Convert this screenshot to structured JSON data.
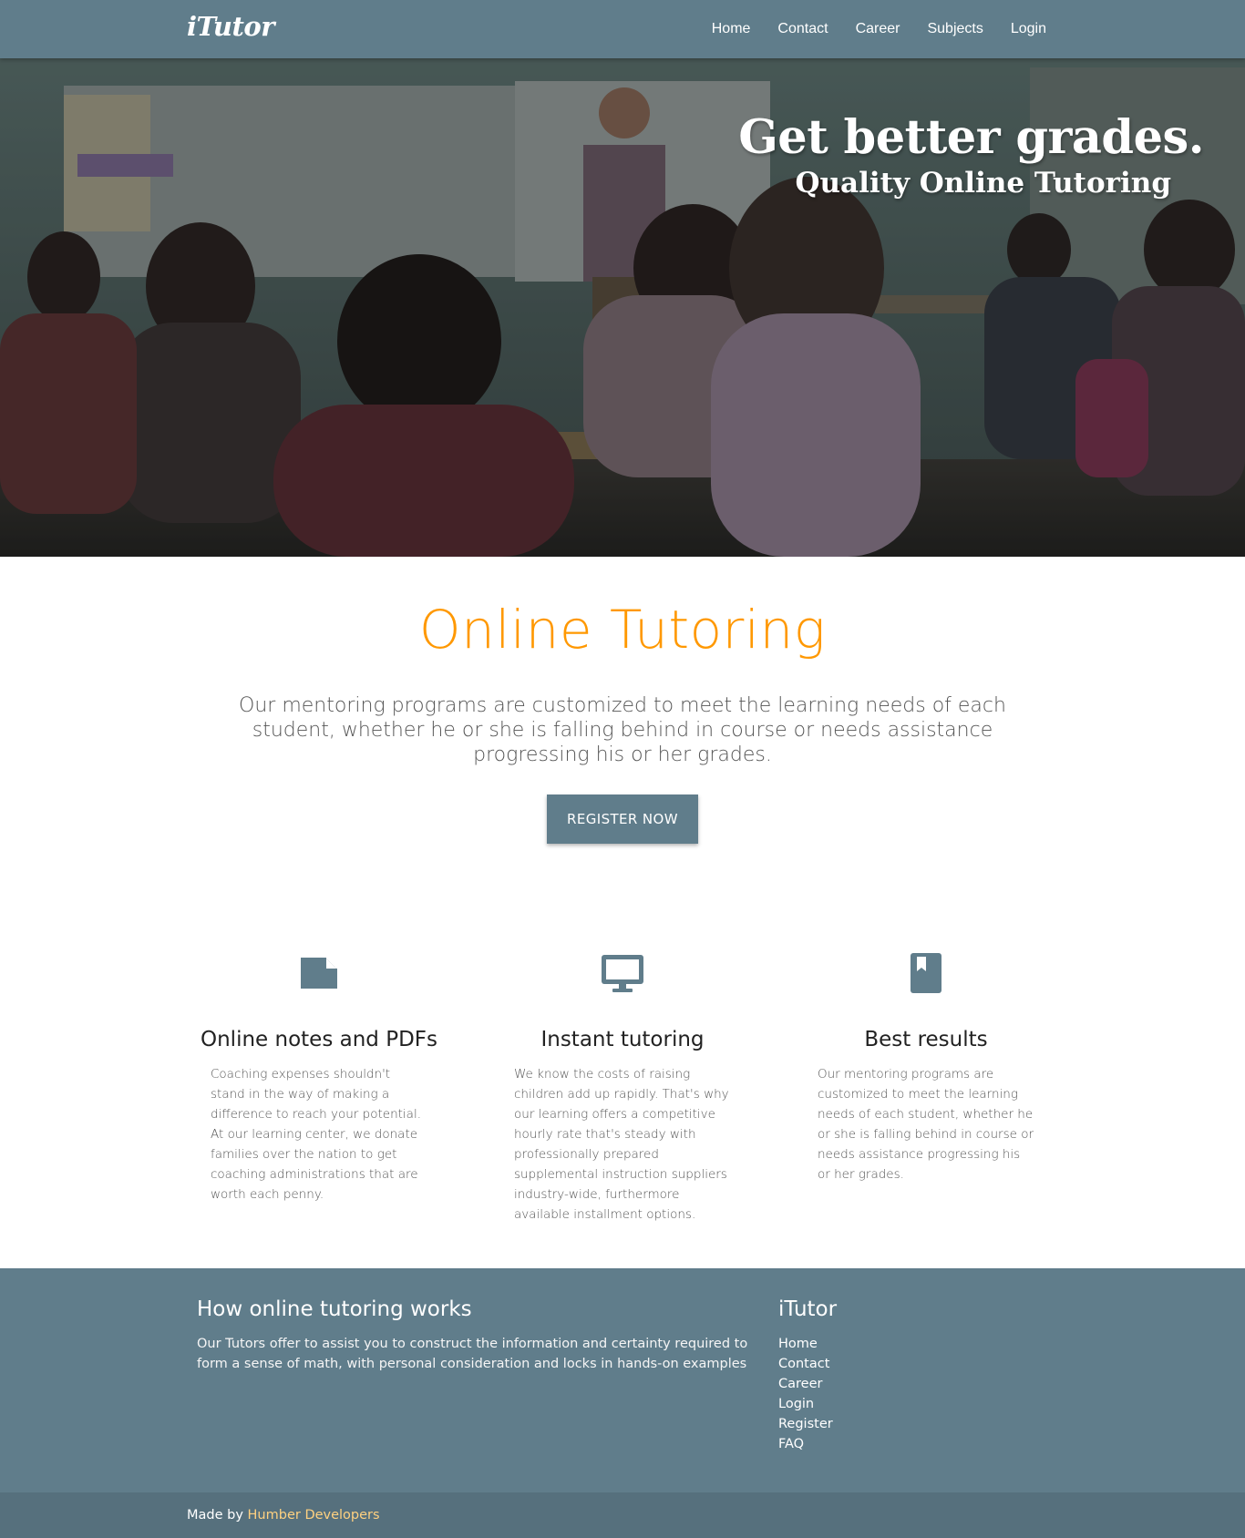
{
  "navbar": {
    "brand": "iTutor",
    "links": [
      "Home",
      "Contact",
      "Career",
      "Subjects",
      "Login"
    ]
  },
  "hero": {
    "title": "Get better grades.",
    "subtitle": "Quality Online Tutoring"
  },
  "intro": {
    "title": "Online Tutoring",
    "text": "Our mentoring programs are customized to meet the learning needs of each student, whether he or she is falling behind in course or needs assistance progressing his or her grades.",
    "button": "REGISTER NOW"
  },
  "features": [
    {
      "icon": "note-icon",
      "title": "Online notes and PDFs",
      "text": "Coaching expenses shouldn't stand in the way of making a difference to reach your potential. At our learning center, we donate families over the nation to get coaching administrations that are worth each penny."
    },
    {
      "icon": "monitor-icon",
      "title": "Instant tutoring",
      "text": "We know the costs of raising children add up rapidly. That's why our learning offers a competitive hourly rate that's steady with professionally prepared supplemental instruction suppliers industry-wide, furthermore available installment options."
    },
    {
      "icon": "book-icon",
      "title": "Best results",
      "text": "Our mentoring programs are customized to meet the learning needs of each student, whether he or she is falling behind in course or needs assistance progressing his or her grades."
    }
  ],
  "footer": {
    "left_heading": "How online tutoring works",
    "left_text": "Our Tutors offer to assist you to construct the information and certainty required to form a sense of math, with personal consideration and locks in hands-on examples",
    "right_heading": "iTutor",
    "links": [
      "Home",
      "Contact",
      "Career",
      "Login",
      "Register",
      "FAQ"
    ],
    "made_by": "Made by",
    "credit": "Humber Developers"
  },
  "colors": {
    "primary": "#607d8b",
    "accent": "#ff9800",
    "credit": "#ffd180"
  }
}
